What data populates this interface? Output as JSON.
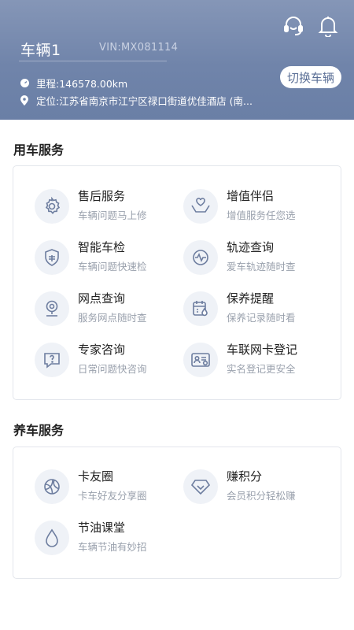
{
  "header": {
    "vehicle_name": "车辆1",
    "vin": "VIN:MX081114",
    "switch_label": "切换车辆",
    "mileage": "里程:146578.00km",
    "location": "定位:江苏省南京市江宁区禄口街道优佳酒店 (南..."
  },
  "vehicle_service": {
    "title": "用车服务",
    "items": [
      {
        "title": "售后服务",
        "desc": "车辆问题马上修",
        "icon": "gear-icon"
      },
      {
        "title": "增值伴侣",
        "desc": "增值服务任您选",
        "icon": "care-hands-icon"
      },
      {
        "title": "智能车检",
        "desc": "车辆问题快速检",
        "icon": "shield-check-icon"
      },
      {
        "title": "轨迹查询",
        "desc": "爱车轨迹随时查",
        "icon": "pulse-icon"
      },
      {
        "title": "网点查询",
        "desc": "服务网点随时查",
        "icon": "location-pin-icon"
      },
      {
        "title": "保养提醒",
        "desc": "保养记录随时看",
        "icon": "calendar-drop-icon"
      },
      {
        "title": "专家咨询",
        "desc": "日常问题快咨询",
        "icon": "question-chat-icon"
      },
      {
        "title": "车联网卡登记",
        "desc": "实名登记更安全",
        "icon": "id-card-icon"
      }
    ]
  },
  "care_service": {
    "title": "养车服务",
    "items": [
      {
        "title": "卡友圈",
        "desc": "卡车好友分享圈",
        "icon": "circle-share-icon"
      },
      {
        "title": "赚积分",
        "desc": "会员积分轻松赚",
        "icon": "diamond-icon"
      },
      {
        "title": "节油课堂",
        "desc": "车辆节油有妙招",
        "icon": "drop-icon"
      }
    ]
  }
}
